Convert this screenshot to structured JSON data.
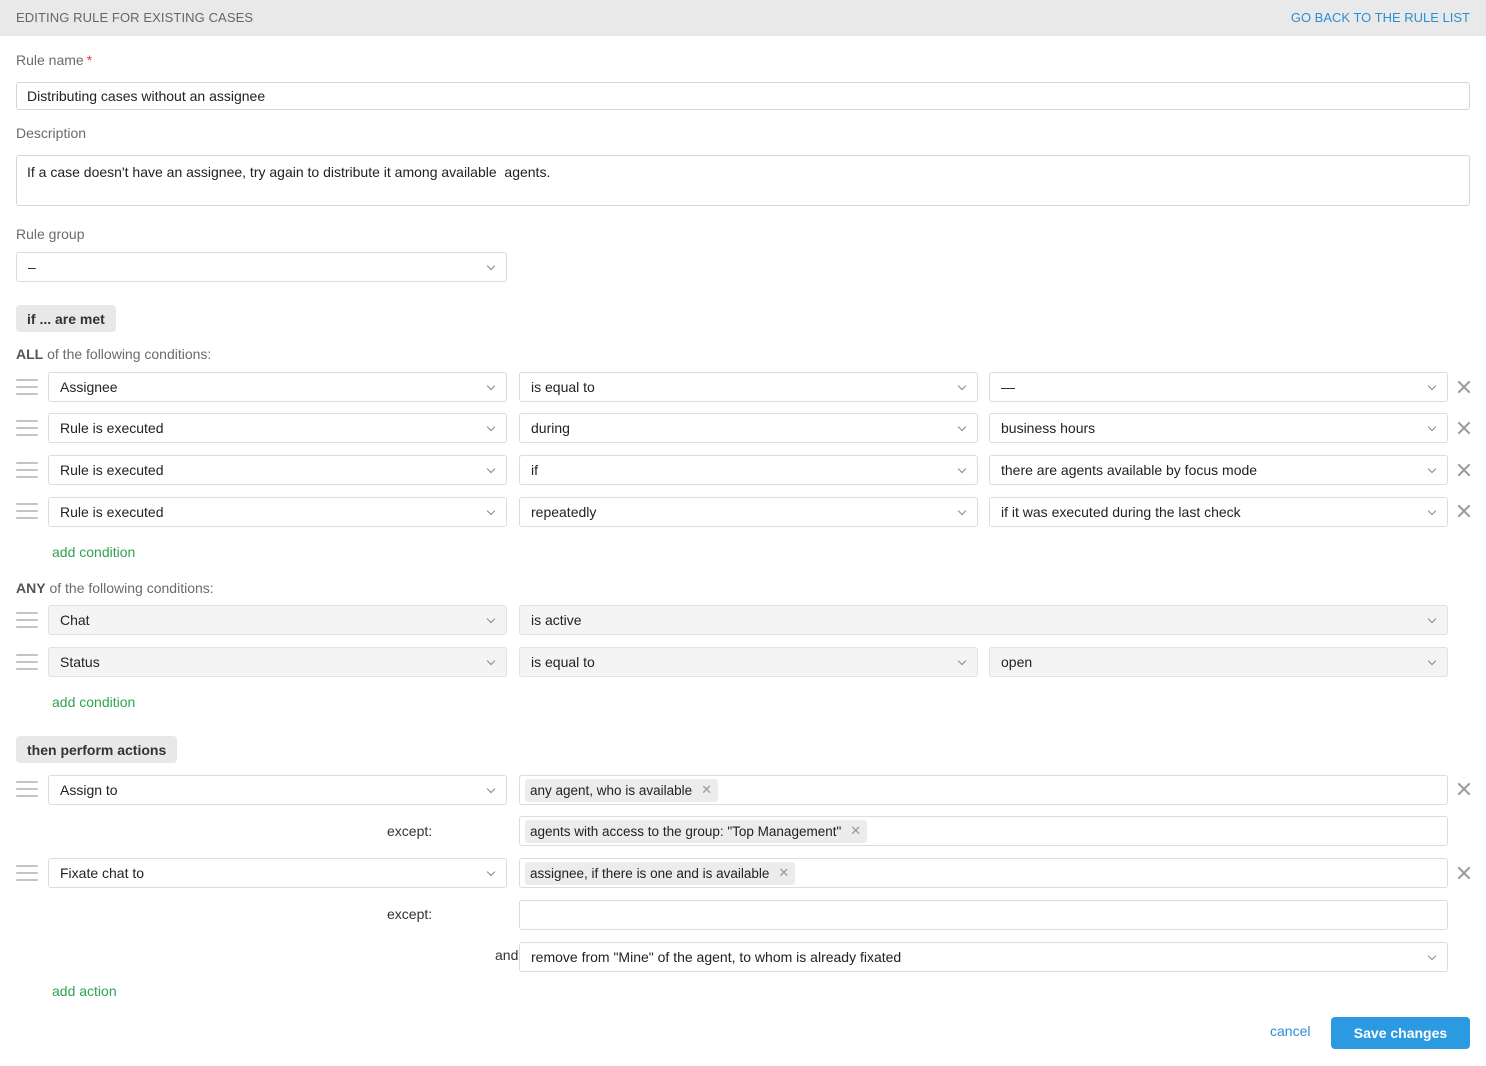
{
  "header": {
    "title": "EDITING RULE FOR EXISTING CASES",
    "back_link": "GO BACK TO THE RULE LIST"
  },
  "form": {
    "rule_name_label": "Rule name",
    "required_mark": "*",
    "rule_name_value": "Distributing cases without an assignee",
    "description_label": "Description",
    "description_value": "If a case doesn't have an assignee, try again to distribute it among available  agents.",
    "rule_group_label": "Rule group",
    "rule_group_value": "–"
  },
  "conditions": {
    "section_badge": "if ... are met",
    "all_group": {
      "keyword": "ALL",
      "label": " of the following conditions:",
      "rows": [
        {
          "field": "Assignee",
          "operator": "is equal to",
          "value": "—"
        },
        {
          "field": "Rule is executed",
          "operator": "during",
          "value": "business hours"
        },
        {
          "field": "Rule is executed",
          "operator": "if",
          "value": "there are agents available by focus mode"
        },
        {
          "field": "Rule is executed",
          "operator": "repeatedly",
          "value": "if it was executed during the last check"
        }
      ],
      "add_label": "add condition"
    },
    "any_group": {
      "keyword": "ANY",
      "label": " of the following conditions:",
      "rows": [
        {
          "field": "Chat",
          "operator": "is active"
        },
        {
          "field": "Status",
          "operator": "is equal to",
          "value": "open"
        }
      ],
      "add_label": "add condition"
    }
  },
  "actions": {
    "section_badge": "then perform actions",
    "rows": [
      {
        "action": "Assign to",
        "target_tag": "any agent, who is available",
        "except_label": "except:",
        "except_tag": "agents with access to the group: \"Top Management\""
      },
      {
        "action": "Fixate chat to",
        "target_tag": "assignee, if there is one and is available",
        "except_label": "except:",
        "and_label": "and",
        "and_value": "remove from \"Mine\" of the agent, to whom is already fixated"
      }
    ],
    "add_label": "add action"
  },
  "footer": {
    "cancel": "cancel",
    "save": "Save changes"
  },
  "colors": {
    "accent_blue": "#2b9ae0",
    "link_green": "#2ea44f",
    "required_red": "#e0403a"
  }
}
